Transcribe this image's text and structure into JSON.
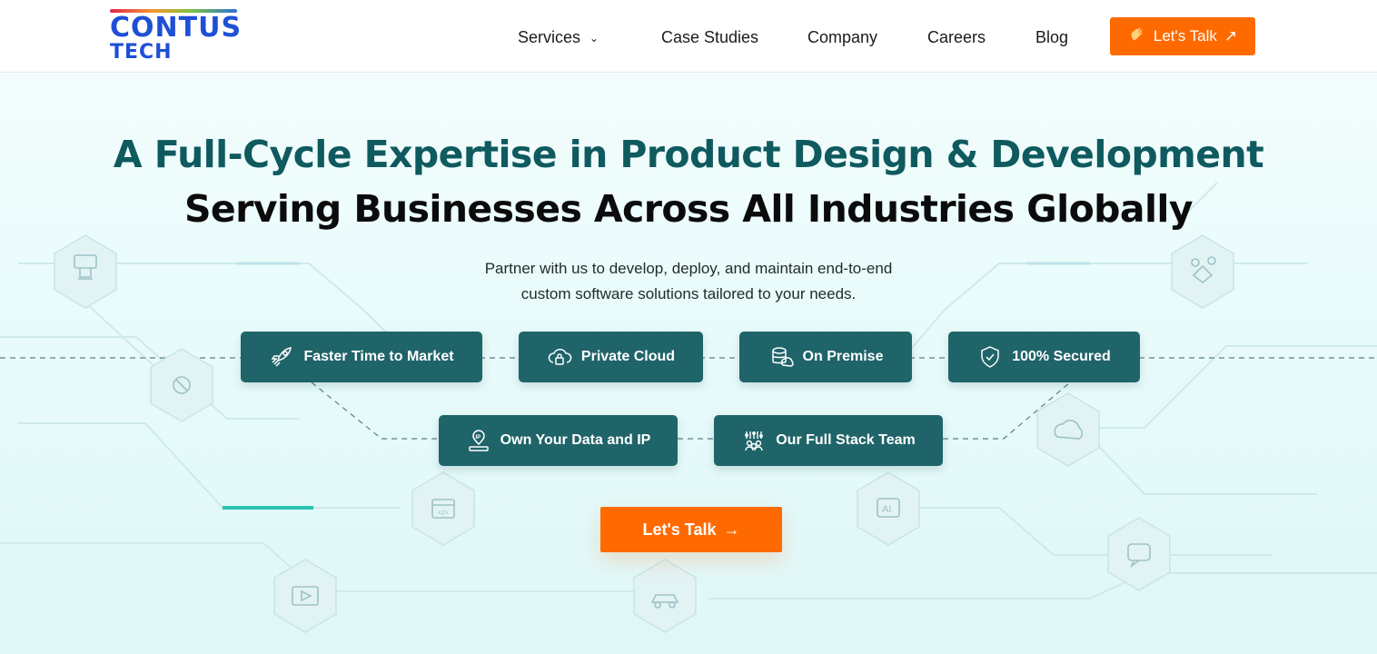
{
  "brand": {
    "line1": "CONTUS",
    "line2": "TECH"
  },
  "nav": {
    "services": "Services",
    "case_studies": "Case Studies",
    "company": "Company",
    "careers": "Careers",
    "blog": "Blog",
    "talk_label": "Let's Talk"
  },
  "hero": {
    "headline1": "A Full-Cycle Expertise in Product Design & Development",
    "headline2": "Serving Businesses Across All Industries Globally",
    "sub_line1": "Partner with us to develop, deploy, and maintain end-to-end",
    "sub_line2": "custom software solutions tailored to your needs.",
    "features": [
      {
        "label": "Faster Time to Market",
        "icon": "rocket-icon"
      },
      {
        "label": "Private Cloud",
        "icon": "cloud-lock-icon"
      },
      {
        "label": "On Premise",
        "icon": "database-icon"
      },
      {
        "label": "100% Secured",
        "icon": "shield-check-icon"
      },
      {
        "label": "Own Your Data and IP",
        "icon": "ip-icon"
      },
      {
        "label": "Our Full Stack Team",
        "icon": "team-icon"
      }
    ],
    "cta_label": "Let's Talk"
  },
  "colors": {
    "accent": "#ff6a00",
    "brand_blue": "#1e4fd6",
    "pill_teal": "#1f6469",
    "headline_teal": "#0e5a5f"
  }
}
